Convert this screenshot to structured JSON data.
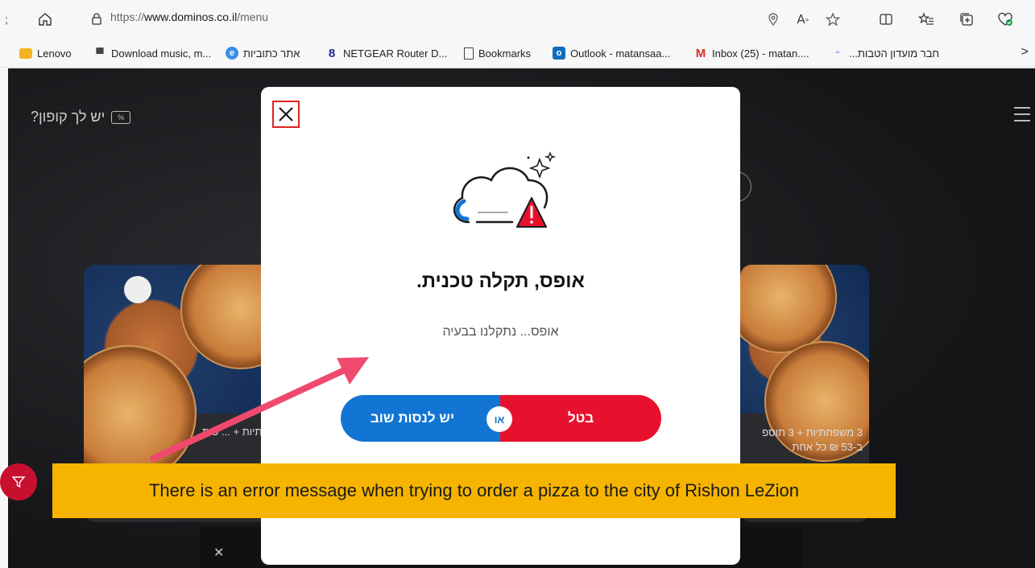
{
  "browser": {
    "url_prefix": "https://",
    "url_domain": "www.dominos.co.il",
    "url_path": "/menu",
    "icons": [
      "home-icon",
      "site-info-icon",
      "location-icon",
      "read-aloud-icon",
      "favorite-star-icon",
      "split-screen-icon",
      "favorites-icon",
      "collections-icon",
      "health-icon"
    ]
  },
  "bookmarks": [
    {
      "label": "Lenovo",
      "icon": "folder-icon",
      "color": "#f2b321"
    },
    {
      "label": "Download music, m...",
      "icon": "music-download-icon",
      "color": "#444444"
    },
    {
      "label": "אתר כתוביות",
      "icon": "subtitles-site-icon",
      "color": "#3a8ee6"
    },
    {
      "label": "NETGEAR Router D...",
      "icon": "netgear-icon",
      "color": "#2a2a8a"
    },
    {
      "label": "Bookmarks",
      "icon": "page-icon",
      "color": "#444444"
    },
    {
      "label": "Outlook - matansaa...",
      "icon": "outlook-icon",
      "color": "#0f6cbd"
    },
    {
      "label": "Inbox (25) - matan....",
      "icon": "gmail-icon",
      "color": "#d93025"
    },
    {
      "label": "חבר מועדון הטבות...",
      "icon": "club-icon",
      "color": "#8ab4f8"
    }
  ],
  "page": {
    "coupon_label": "יש לך קופון?",
    "coupon_tag": "%",
    "card_left_caption": "חתיות + ... פות",
    "card_right_caption_1": "3 משפחתיות + 3 תוספ",
    "card_right_caption_2": "ב-53 ₪ כל אחת"
  },
  "modal": {
    "title": "אופס, תקלה טכנית.",
    "message": "אופס... נתקלנו בבעיה",
    "retry_label": "יש לנסות שוב",
    "or_label": "או",
    "cancel_label": "בטל",
    "colors": {
      "retry": "#1275d3",
      "cancel": "#e8112d"
    }
  },
  "annotation": {
    "text": "There is an error message when trying to order a pizza to the city of Rishon LeZion",
    "color": "#f6b400"
  }
}
